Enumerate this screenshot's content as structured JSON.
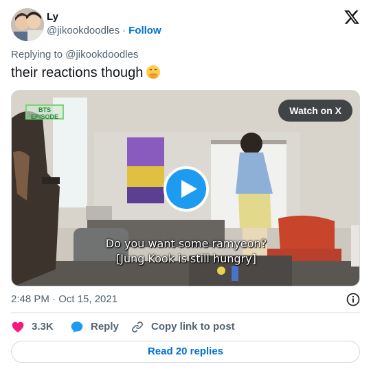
{
  "author": {
    "display_name": "Ly",
    "handle": "@jikookdoodles",
    "separator": "·",
    "follow_label": "Follow"
  },
  "replying_to": "Replying to @jikookdoodles",
  "tweet": {
    "text": "their reactions though",
    "emoji": "face-with-hand-over-mouth"
  },
  "media": {
    "watch_label": "Watch on X",
    "channel_logo": "BTS EPISODE",
    "subtitle_line1": "Do you want some ramyeon?",
    "subtitle_line2": "[Jung Kook is still hungry]"
  },
  "timestamp": "2:48 PM · Oct 15, 2021",
  "actions": {
    "like_count": "3.3K",
    "reply_label": "Reply",
    "copy_label": "Copy link to post"
  },
  "read_replies_label": "Read 20 replies",
  "colors": {
    "link": "#006fd6",
    "like": "#f91880",
    "reply_icon": "#1d9bf0",
    "play": "#1d9bf0",
    "muted": "#536471",
    "border": "#cfd9de"
  },
  "icons": [
    "x-logo-icon",
    "play-icon",
    "heart-icon",
    "reply-bubble-icon",
    "link-icon",
    "info-icon"
  ]
}
